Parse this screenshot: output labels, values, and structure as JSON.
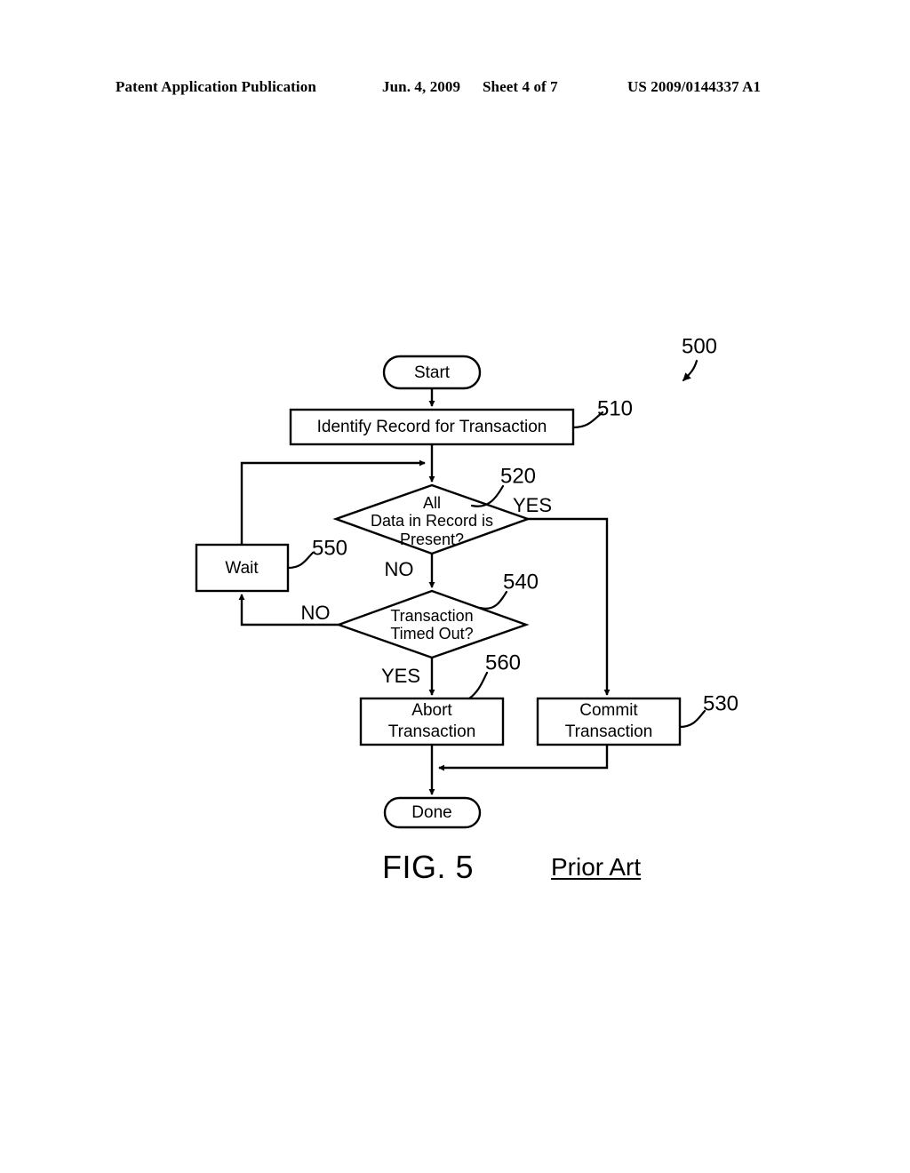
{
  "header": {
    "publication": "Patent Application Publication",
    "date": "Jun. 4, 2009",
    "sheet": "Sheet 4 of 7",
    "document_number": "US 2009/0144337 A1"
  },
  "figure": {
    "caption": "FIG. 5",
    "prior_art_note": "Prior Art",
    "diagram_reference": "500"
  },
  "flowchart": {
    "type": "flowchart",
    "nodes": {
      "start": {
        "label": "Start",
        "shape": "terminator"
      },
      "identify": {
        "label": "Identify Record for Transaction",
        "shape": "process",
        "ref": "510"
      },
      "data_present": {
        "label_line1": "All",
        "label_line2": "Data in Record is",
        "label_line3": "Present?",
        "shape": "decision",
        "ref": "520"
      },
      "wait": {
        "label": "Wait",
        "shape": "process",
        "ref": "550"
      },
      "timed_out": {
        "label_line1": "Transaction",
        "label_line2": "Timed Out?",
        "shape": "decision",
        "ref": "540"
      },
      "abort": {
        "label_line1": "Abort",
        "label_line2": "Transaction",
        "shape": "process",
        "ref": "560"
      },
      "commit": {
        "label_line1": "Commit",
        "label_line2": "Transaction",
        "shape": "process",
        "ref": "530"
      },
      "done": {
        "label": "Done",
        "shape": "terminator"
      }
    },
    "edge_labels": {
      "data_present_yes": "YES",
      "data_present_no": "NO",
      "timed_out_no": "NO",
      "timed_out_yes": "YES"
    }
  },
  "colors": {
    "ink": "#000000",
    "paper": "#ffffff"
  }
}
